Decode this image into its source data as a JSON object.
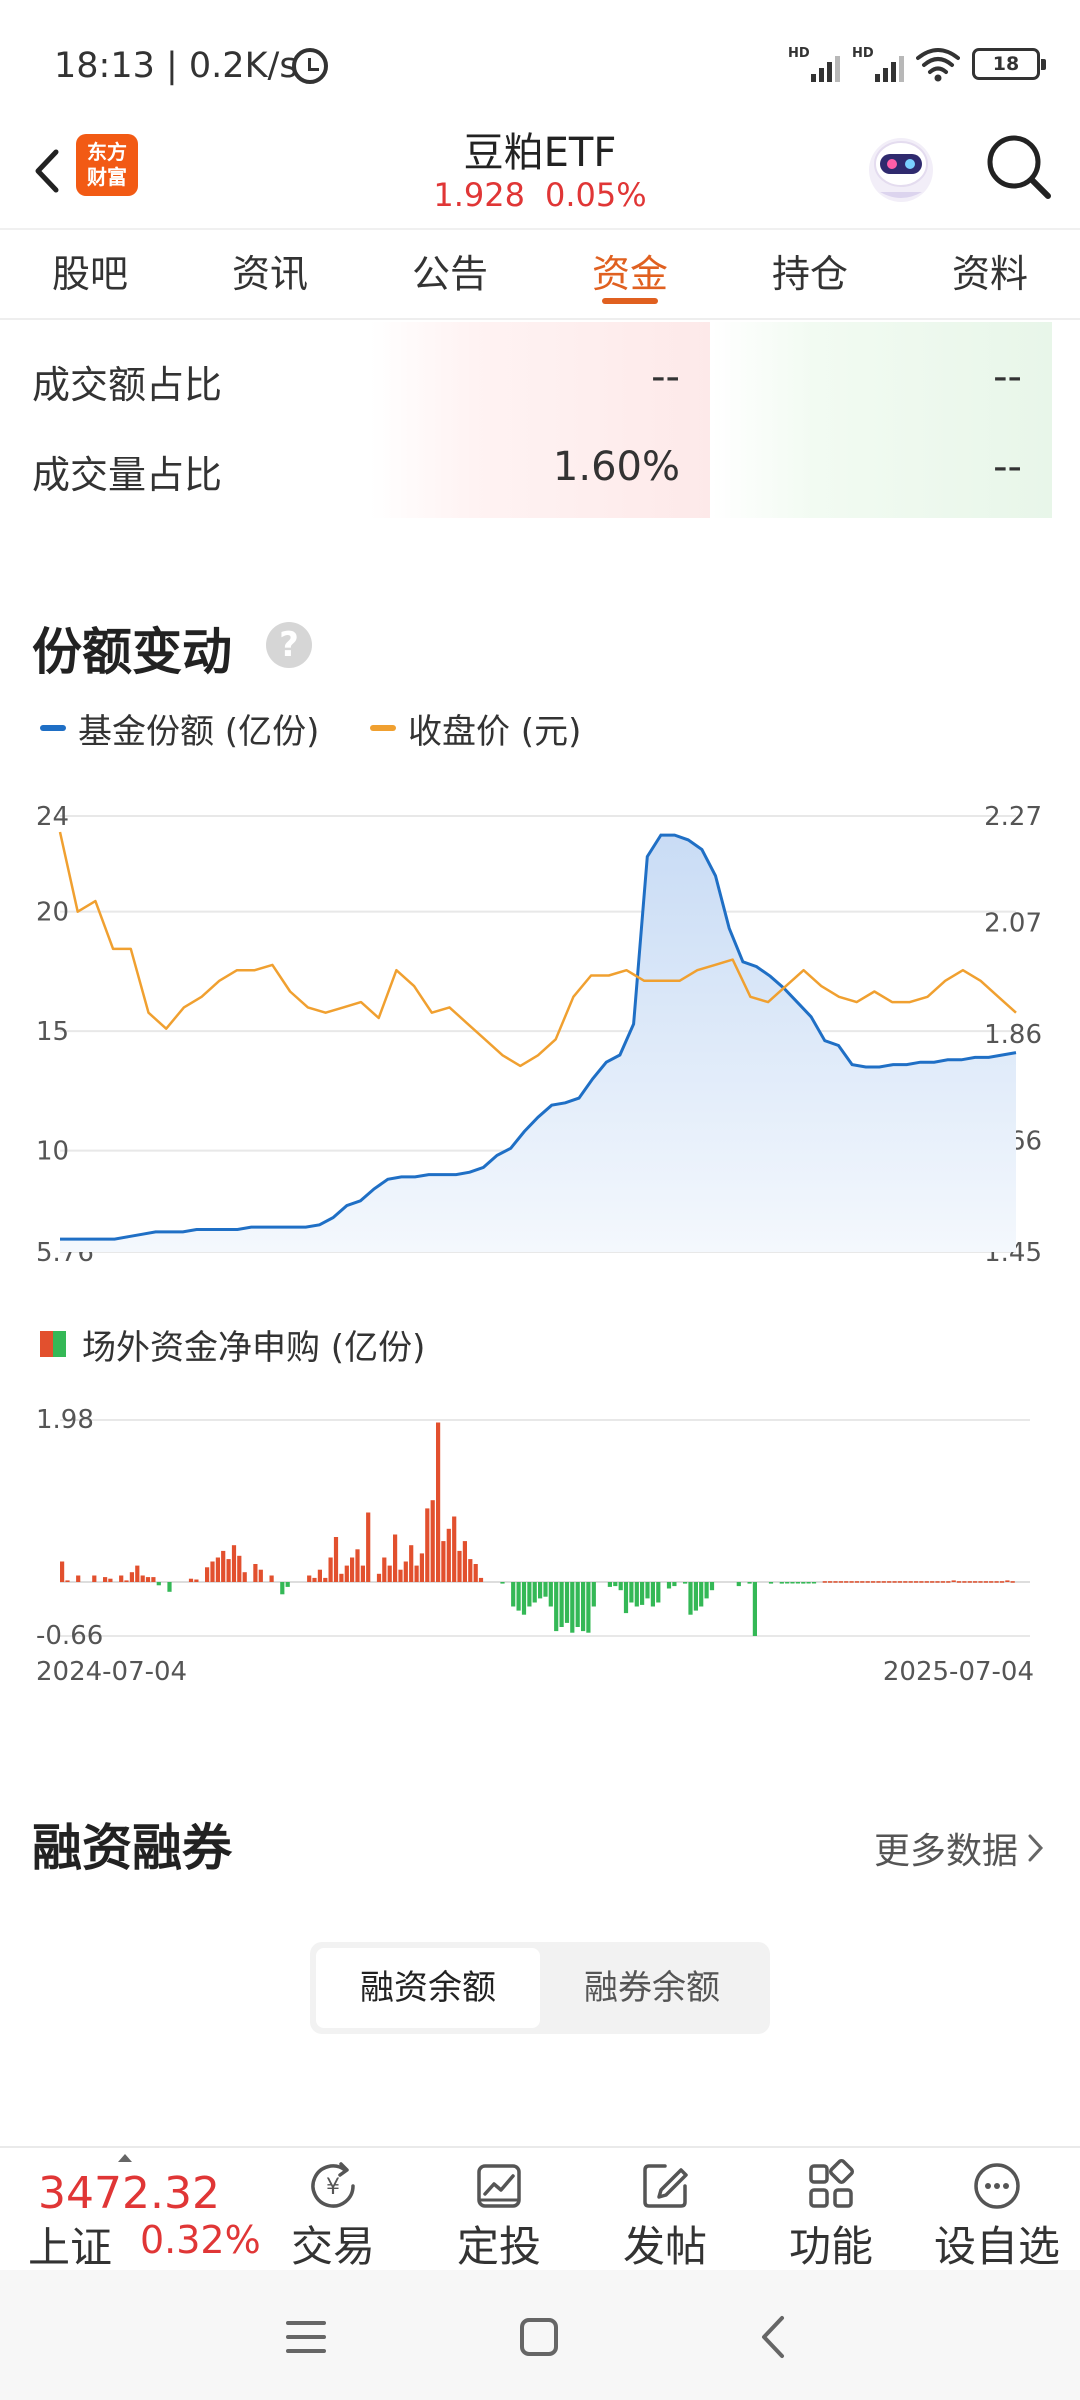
{
  "status_bar": {
    "time_speed": "18:13 | 0.2K/s",
    "battery": "18"
  },
  "header": {
    "brand_logo": [
      "东方",
      "财富"
    ],
    "title": "豆粕ETF",
    "price": "1.928",
    "change_pct": "0.05%"
  },
  "tabs": [
    {
      "label": "股吧"
    },
    {
      "label": "资讯"
    },
    {
      "label": "公告"
    },
    {
      "label": "资金",
      "active": true
    },
    {
      "label": "持仓"
    },
    {
      "label": "资料"
    }
  ],
  "ratios": [
    {
      "label": "成交额占比",
      "value_red": "--",
      "value_green": "--"
    },
    {
      "label": "成交量占比",
      "value_red": "1.60%",
      "value_green": "--"
    }
  ],
  "share_change": {
    "title": "份额变动",
    "legend_share": "基金份额 (亿份)",
    "legend_price": "收盘价 (元)",
    "colors": {
      "share": "#1f6fc5",
      "price": "#f0a030",
      "area_top": "#cfe0f6"
    }
  },
  "chart_data": [
    {
      "type": "line",
      "series": [
        {
          "name": "基金份额 (亿份)",
          "axis": "left",
          "values": [
            6.3,
            6.3,
            6.3,
            6.3,
            6.3,
            6.4,
            6.5,
            6.6,
            6.6,
            6.6,
            6.7,
            6.7,
            6.7,
            6.7,
            6.8,
            6.8,
            6.8,
            6.8,
            6.8,
            6.9,
            7.2,
            7.7,
            7.9,
            8.4,
            8.8,
            8.9,
            8.9,
            9.0,
            9.0,
            9.0,
            9.1,
            9.3,
            9.8,
            10.1,
            10.8,
            11.4,
            11.9,
            12.0,
            12.2,
            13.0,
            13.7,
            14.0,
            15.3,
            22.3,
            23.2,
            23.2,
            23.0,
            22.6,
            21.5,
            19.3,
            17.9,
            17.7,
            17.3,
            16.8,
            16.2,
            15.6,
            14.6,
            14.4,
            13.6,
            13.5,
            13.5,
            13.6,
            13.6,
            13.7,
            13.7,
            13.8,
            13.8,
            13.9,
            13.9,
            14.0,
            14.1
          ]
        },
        {
          "name": "收盘价 (元)",
          "axis": "right",
          "values": [
            2.24,
            2.09,
            2.11,
            2.02,
            2.02,
            1.9,
            1.87,
            1.91,
            1.93,
            1.96,
            1.98,
            1.98,
            1.99,
            1.94,
            1.91,
            1.9,
            1.91,
            1.92,
            1.89,
            1.98,
            1.95,
            1.9,
            1.91,
            1.88,
            1.85,
            1.82,
            1.8,
            1.82,
            1.85,
            1.93,
            1.97,
            1.97,
            1.98,
            1.96,
            1.96,
            1.96,
            1.98,
            1.99,
            2.0,
            1.93,
            1.92,
            1.95,
            1.98,
            1.95,
            1.93,
            1.92,
            1.94,
            1.92,
            1.92,
            1.93,
            1.96,
            1.98,
            1.96,
            1.93,
            1.9
          ]
        }
      ],
      "x_labels": [],
      "y_left": {
        "ticks": [
          "24",
          "20",
          "15",
          "10",
          "5.76"
        ],
        "ylim": [
          5.76,
          24
        ]
      },
      "y_right": {
        "ticks": [
          "2.27",
          "2.07",
          "1.86",
          "1.66",
          "1.45"
        ],
        "ylim": [
          1.45,
          2.27
        ]
      },
      "grid": true
    },
    {
      "type": "bar",
      "title": "场外资金净申购 (亿份)",
      "x_start": "2024-07-04",
      "x_end": "2025-07-04",
      "ylim": [
        -0.66,
        1.98
      ],
      "y_ticks": [
        "1.98",
        "-0.66"
      ],
      "colors": {
        "positive": "#e2502e",
        "negative": "#34b856"
      },
      "values": [
        0.25,
        0.02,
        0,
        0.08,
        0,
        0,
        0.08,
        0,
        0.06,
        0.04,
        0,
        0.08,
        0.02,
        0.12,
        0.2,
        0.08,
        0.06,
        0.06,
        -0.04,
        0,
        -0.12,
        0,
        0,
        0,
        0.04,
        0.03,
        0,
        0.18,
        0.25,
        0.3,
        0.38,
        0.28,
        0.45,
        0.32,
        0.12,
        0,
        0.22,
        0.15,
        0,
        0.08,
        0,
        -0.15,
        -0.06,
        0,
        0,
        0,
        0.08,
        0.05,
        0.15,
        0.05,
        0.3,
        0.55,
        0.1,
        0.2,
        0.3,
        0.4,
        0.2,
        0.85,
        0,
        0.1,
        0.3,
        0.2,
        0.58,
        0.15,
        0.25,
        0.45,
        0.2,
        0.35,
        0.9,
        1.0,
        1.95,
        0.5,
        0.65,
        0.8,
        0.38,
        0.5,
        0.28,
        0.22,
        0.05,
        0,
        0,
        0,
        -0.02,
        0,
        -0.3,
        -0.35,
        -0.4,
        -0.3,
        -0.25,
        -0.2,
        -0.18,
        -0.3,
        -0.6,
        -0.55,
        -0.5,
        -0.62,
        -0.55,
        -0.6,
        -0.62,
        -0.3,
        0,
        0,
        -0.06,
        -0.05,
        -0.1,
        -0.38,
        -0.25,
        -0.3,
        -0.28,
        -0.2,
        -0.3,
        -0.25,
        0,
        -0.08,
        -0.05,
        0,
        -0.02,
        -0.4,
        -0.35,
        -0.3,
        -0.2,
        -0.1,
        0,
        0,
        0,
        0,
        -0.05,
        0,
        -0.02,
        -0.66,
        0,
        0,
        -0.02,
        0,
        -0.02,
        -0.01,
        -0.01,
        -0.01,
        -0.02,
        -0.01,
        -0.01,
        0,
        0.01,
        0.01,
        0.01,
        0.01,
        0.01,
        0.01,
        0.01,
        0.01,
        0.01,
        0.01,
        0.01,
        0.01,
        0.01,
        0.01,
        0.01,
        0.01,
        0.01,
        0.01,
        0.01,
        0.01,
        0.01,
        0.01,
        0.01,
        0.01,
        0.02,
        0.01,
        0.01,
        0.01,
        0.01,
        0.01,
        0.01,
        0.01,
        0.01,
        0.01,
        0.02,
        0.01
      ]
    }
  ],
  "margin_trading": {
    "title": "融资融券",
    "more_label": "更多数据",
    "tabs": [
      {
        "label": "融资余额",
        "active": true
      },
      {
        "label": "融券余额"
      }
    ]
  },
  "bottom_bar": {
    "index_value": "3472.32",
    "index_name": "上证",
    "index_change": "0.32%",
    "items": [
      {
        "label": "交易",
        "icon": "trade-icon"
      },
      {
        "label": "定投",
        "icon": "invest-plan-icon"
      },
      {
        "label": "发帖",
        "icon": "post-icon"
      },
      {
        "label": "功能",
        "icon": "functions-icon"
      },
      {
        "label": "设自选",
        "icon": "add-watchlist-icon"
      }
    ]
  }
}
